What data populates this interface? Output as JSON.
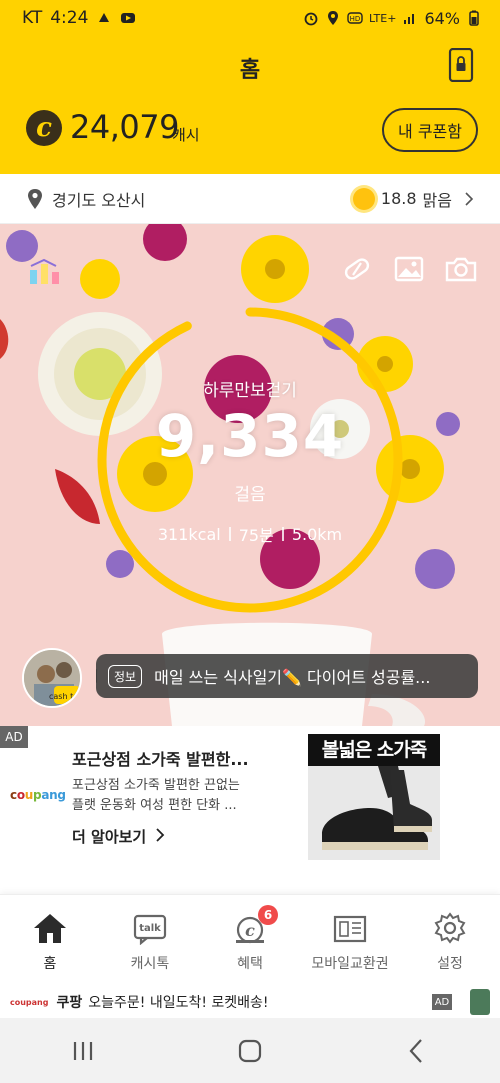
{
  "status_bar": {
    "carrier": "KT",
    "time": "4:24",
    "network": "LTE+",
    "battery": "64%"
  },
  "header": {
    "title": "홈",
    "cash_amount": "24,079",
    "cash_unit": "캐시",
    "coupon_button": "내 쿠폰함"
  },
  "location": {
    "name": "경기도 오산시",
    "temperature": "18.8",
    "condition": "맑음"
  },
  "steps": {
    "title": "하루만보걷기",
    "count": "9,334",
    "unit": "걸음",
    "kcal": "311kcal",
    "minutes": "75분",
    "distance": "5.0km",
    "progress": 0.93
  },
  "talk": {
    "tag": "정보",
    "message": "매일 쓰는 식사일기✏️ 다이어트 성공률...",
    "avatar_tag": "cash talk"
  },
  "ad": {
    "tag": "AD",
    "brand": "coupang",
    "title": "포근상점 소가죽 발편한...",
    "desc_line1": "포근상점 소가죽 발편한 끈없는",
    "desc_line2": "플랫 운동화 여성 편한 단화 ...",
    "more": "더 알아보기",
    "image_text": "볼넓은 소가죽"
  },
  "tabs": [
    {
      "label": "홈",
      "icon": "home-icon"
    },
    {
      "label": "캐시톡",
      "icon": "talk-icon"
    },
    {
      "label": "혜택",
      "icon": "benefit-icon",
      "badge": "6"
    },
    {
      "label": "모바일교환권",
      "icon": "ticket-icon"
    },
    {
      "label": "설정",
      "icon": "gear-icon"
    }
  ],
  "banner": {
    "logo": "coupang",
    "brand": "쿠팡",
    "text": "오늘주문! 내일도착! 로켓배송!",
    "ad": "AD"
  },
  "colors": {
    "brand_yellow": "#ffd200",
    "ring": "#ffc800",
    "badge_red": "#f04b4b"
  }
}
